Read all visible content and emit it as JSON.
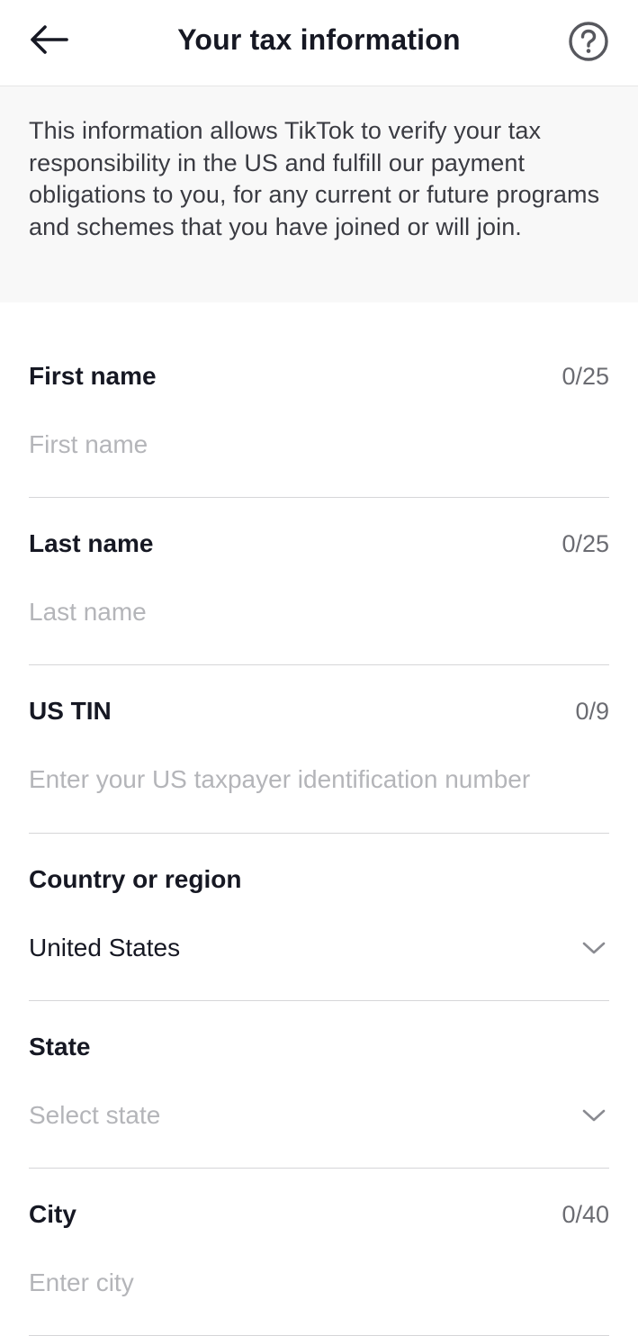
{
  "header": {
    "title": "Your tax information",
    "back_icon": "arrow-left-icon",
    "help_icon": "question-circle-icon"
  },
  "intro": {
    "text": "This information allows TikTok to verify your tax responsibility in the US and fulfill our payment obligations to you, for any current or future programs and schemes that you have joined or will join."
  },
  "form": {
    "first_name": {
      "label": "First name",
      "counter": "0/25",
      "value": "",
      "placeholder": "First name"
    },
    "last_name": {
      "label": "Last name",
      "counter": "0/25",
      "value": "",
      "placeholder": "Last name"
    },
    "us_tin": {
      "label": "US TIN",
      "counter": "0/9",
      "value": "",
      "placeholder": "Enter your US taxpayer identification number"
    },
    "country": {
      "label": "Country or region",
      "value": "United States",
      "icon": "chevron-down-icon"
    },
    "state": {
      "label": "State",
      "placeholder": "Select state",
      "icon": "chevron-down-icon"
    },
    "city": {
      "label": "City",
      "counter": "0/40",
      "value": "",
      "placeholder": "Enter city"
    }
  },
  "colors": {
    "text_primary": "#161823",
    "text_secondary": "#6b6c72",
    "placeholder": "#b4b5b9",
    "intro_bg": "#f8f8f8",
    "divider": "#d6d6d8"
  }
}
